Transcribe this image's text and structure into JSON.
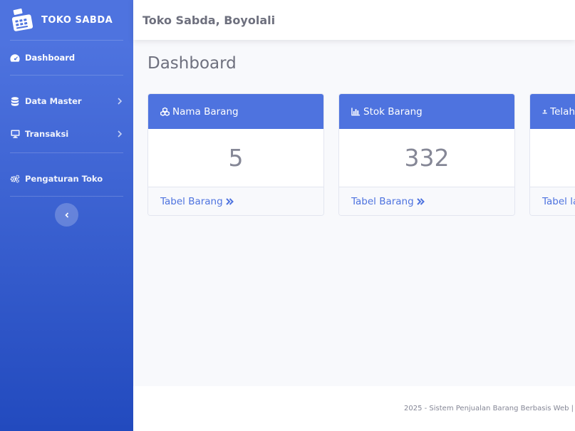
{
  "brand": {
    "name": "TOKO SABDA",
    "icon": "register-icon"
  },
  "sidebar": {
    "items": [
      {
        "label": "Dashboard",
        "icon": "tachometer-icon"
      },
      {
        "label": "Data Master",
        "icon": "database-icon"
      },
      {
        "label": "Transaksi",
        "icon": "desktop-icon"
      },
      {
        "label": "Pengaturan Toko",
        "icon": "cogs-icon"
      }
    ],
    "toggle_icon": "chevron-left-icon"
  },
  "topbar": {
    "title": "Toko Sabda, Boyolali"
  },
  "page": {
    "title": "Dashboard"
  },
  "cards": [
    {
      "header": "Nama Barang",
      "value": "5",
      "footer": "Tabel Barang",
      "icon": "cubes-icon"
    },
    {
      "header": "Stok Barang",
      "value": "332",
      "footer": "Tabel Barang",
      "icon": "chart-bar-icon"
    },
    {
      "header": "Telah",
      "value": "",
      "footer": "Tabel la",
      "icon": "upload-icon"
    }
  ],
  "footer": {
    "text": "2025 - Sistem Penjualan Barang Berbasis Web |"
  },
  "colors": {
    "primary": "#4e73df",
    "primary_dark": "#224abe",
    "text_gray": "#858796"
  }
}
